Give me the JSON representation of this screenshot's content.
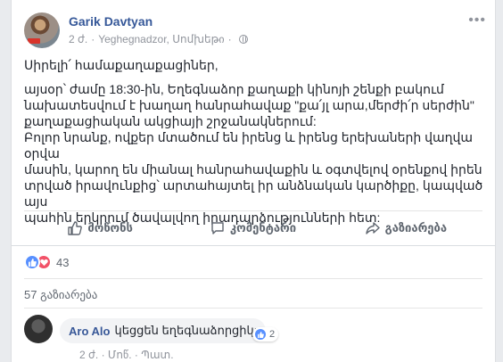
{
  "post": {
    "author": "Garik Davtyan",
    "time": "2 ժ.",
    "location": "Yeghegnadzor, Սոմխեթი",
    "menu_icon": "more-dots-icon",
    "paragraphs": [
      [
        "Սիրելի՛ համաքաղաքացիներ,"
      ],
      [
        "այսօր՝ ժամը 18:30-ին, Եղեգնաձոր քաղաքի կինոյի շենքի բակում",
        "նախատեսվում է խաղաղ հանրահավաք \"քա՛յլ արա,մերժի՛ր սերժին\"",
        "քաղաքացիական ակցիայի շրջանակներում:",
        "Բոլոր նրանք, ովքեր մտածում են իրենց և իրենց երեխաների վաղվա օրվա",
        "մասին, կարող են միանալ հանրահավաքին և օգտվելով օրենքով իրեն",
        "տրված իրավունքից՝ արտահայտել իր անձնական կարծիքը, կապված այս",
        "պահին երկրում ծավալվող իրադարձությունների հետ:"
      ]
    ]
  },
  "actions": {
    "like_label": "მოწონს",
    "comment_label": "კომენტარი",
    "share_label": "გაზიარება"
  },
  "reactions": {
    "count": "43",
    "like_color": "#5890ff",
    "love_color": "#f25268"
  },
  "shares_label": "57 გაზიარება",
  "comment": {
    "name": "Aro Alo",
    "text": "կեցցեն եղեգնաձորցիկ:",
    "likes": "2",
    "meta": "2 ժ. · Մոწ. · Պատ."
  }
}
